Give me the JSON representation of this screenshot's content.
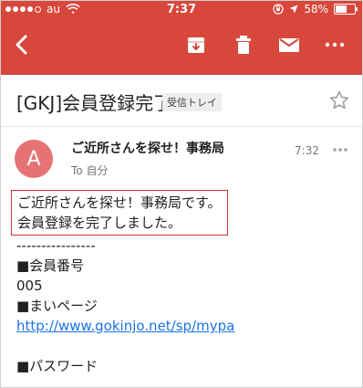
{
  "status_bar": {
    "carrier": "au",
    "time": "7:37",
    "battery": "58%"
  },
  "toolbar": {
    "back_icon": "back-arrow",
    "archive_icon": "archive-box",
    "delete_icon": "trash-can",
    "mark_unread_icon": "envelope",
    "more_icon": "more-dots"
  },
  "email": {
    "subject": "[GKJ]会員登録完了",
    "label": "受信トレイ",
    "sender": {
      "avatar_letter": "A",
      "name": "ご近所さんを探せ！事務局",
      "to": "To 自分",
      "time": "7:32"
    },
    "body": {
      "highlight_lines": [
        "ご近所さんを探せ！事務局です。",
        "会員登録を完了しました。"
      ],
      "lines": [
        "----------------",
        "■会員番号",
        "005",
        "■まいページ",
        "http://www.gokinjo.net/sp/mypa",
        "",
        "■パスワード"
      ]
    }
  },
  "colors": {
    "header_red": "#d8473b",
    "avatar": "#e57373",
    "link": "#1a73e8"
  }
}
